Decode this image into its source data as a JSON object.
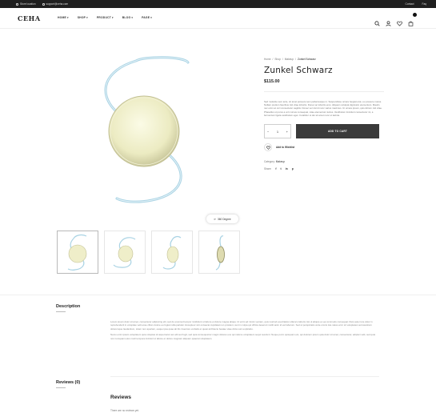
{
  "topbar": {
    "location": "Store location",
    "email": "support@ceha.com",
    "links": [
      "Contact",
      "Faq"
    ]
  },
  "header": {
    "logo": "CEHA",
    "nav": [
      "HOME",
      "SHOP",
      "PRODUCT",
      "BLOG",
      "PAGE"
    ],
    "icons": [
      "search-icon",
      "user-icon",
      "heart-icon",
      "cart-icon"
    ],
    "cart_count": "0"
  },
  "gallery": {
    "zoom_label": "360 Degree",
    "thumbnail_count": 4
  },
  "product": {
    "breadcrumb": [
      "Home",
      "/",
      "Shop",
      "/",
      "Makeup",
      "/",
      "Zunkel Schwarz"
    ],
    "title": "Zunkel Schwarz",
    "price": "$115.00",
    "short_description": "Sed molestie sem ante, sit amet posuere sem pellentesque in. Suspendisse ornare feugiat erat, eu posuere metus. Nullam pretium faucibus nisl vitae lobortis. Donec ac lobortis eros. Aliquam volutpat dignissim elementum. Mauris nec enim at orci consectetur sagittis. Donec vel nisi id nunc varius maximus. Ut ornare ipsum, quis dictum nisl vitae. Phasellus ut purus a orci cursus consequat, vitae elementum lectus. Vestibulum tincidunt consectetur mi, a fermentum ligula vestibulum eget. Curabitur ut dui sit amet nunc ut lacinia.",
    "quantity": "1",
    "qty_minus": "−",
    "qty_plus": "+",
    "add_to_cart": "ADD TO CART",
    "wishlist_label": "Add to Wishlist",
    "category_label": "Category:",
    "category_value": "Makeup",
    "share_label": "Share:",
    "share_icons": [
      "f",
      "t",
      "in",
      "p"
    ]
  },
  "tabs": {
    "description_title": "Description",
    "description_paragraphs": [
      "Lorem ipsum dolor sit amet, consectetur adipiscing elit, sed do eiusmod tempor incididunt ut labore et dolore magna aliqua. Ut enim ad minim veniam, quis nostrud exercitation ullamco laboris nisi ut aliquip ex ea commodo consequat. Duis aute irure dolor in reprehenderit in voluptate velit esse cillum dolore eu fugiat nulla pariatur. Excepteur sint occaecat cupidatat non proident, sunt in culpa qui officia deserunt mollit anim id est laborum. Sed ut perspiciatis unde omnis iste natus error sit voluptatem accusantium doloremque laudantium, totam rem aperiam, eaque ipsa quae ab illo inventore veritatis et quasi architecto beatae vitae dicta sunt explicabo.",
      "Nemo enim ipsam voluptatem quia voluptas sit aspernatur aut odit aut fugit, sed quia consequuntur magni dolores eos qui ratione voluptatem sequi nesciunt. Neque porro quisquam est, qui dolorem ipsum quia dolor sit amet, consectetur, adipisci velit, sed quia non numquam eius modi tempora incidunt ut labore et dolore magnam aliquam quaerat voluptatem."
    ],
    "reviews_tab_title": "Reviews (0)",
    "reviews_heading": "Reviews",
    "no_reviews": "There are no reviews yet."
  }
}
